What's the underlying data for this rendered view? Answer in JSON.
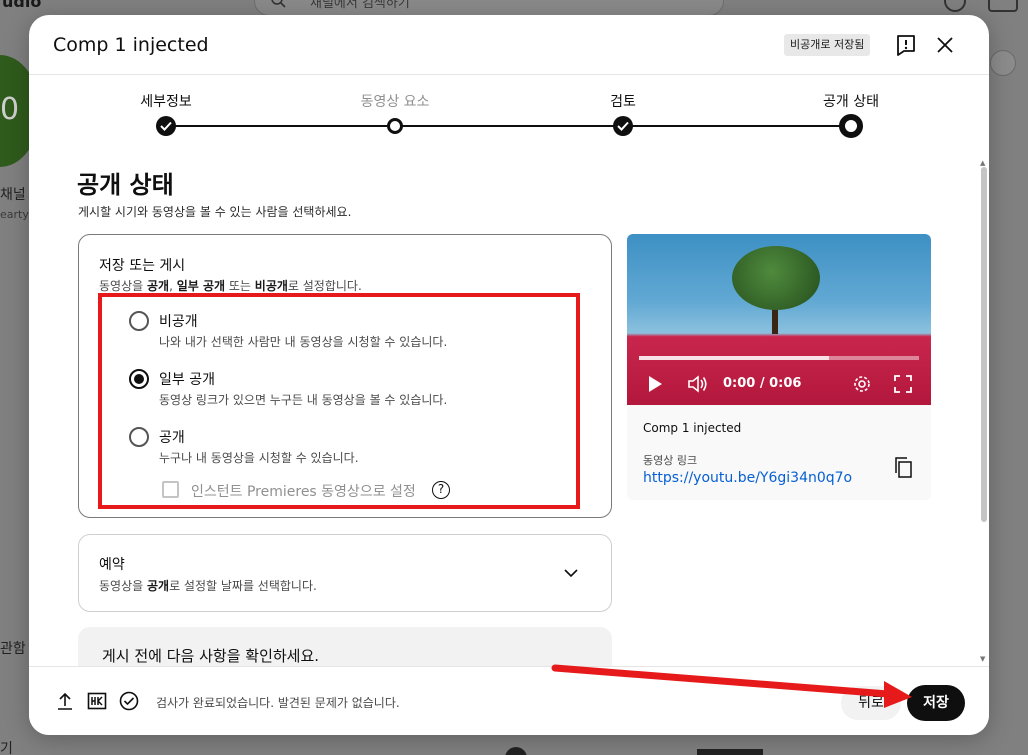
{
  "background": {
    "logo_text": "udio",
    "search_placeholder": "채널에서 검색하기",
    "avatar_letter": "0",
    "channel_label": "채널",
    "channel_sub": "earty",
    "side_item_1": "관함",
    "side_item_2": "기"
  },
  "dialog": {
    "title": "Comp 1 injected",
    "saved_badge": "비공개로 저장됨"
  },
  "stepper": {
    "steps": [
      {
        "label": "세부정보",
        "state": "done"
      },
      {
        "label": "동영상 요소",
        "state": "pending"
      },
      {
        "label": "검토",
        "state": "done"
      },
      {
        "label": "공개 상태",
        "state": "current"
      }
    ]
  },
  "visibility": {
    "title": "공개 상태",
    "subtitle": "게시할 시기와 동영상을 볼 수 있는 사람을 선택하세요.",
    "save_card": {
      "heading": "저장 또는 게시",
      "desc_parts": [
        "동영상을 ",
        "공개",
        ", ",
        "일부 공개",
        " 또는 ",
        "비공개",
        "로 설정합니다."
      ]
    },
    "options": [
      {
        "label": "비공개",
        "desc": "나와 내가 선택한 사람만 내 동영상을 시청할 수 있습니다.",
        "selected": false
      },
      {
        "label": "일부 공개",
        "desc": "동영상 링크가 있으면 누구든 내 동영상을 볼 수 있습니다.",
        "selected": true
      },
      {
        "label": "공개",
        "desc": "누구나 내 동영상을 시청할 수 있습니다.",
        "selected": false
      }
    ],
    "instant_premiere_label": "인스턴트 Premieres 동영상으로 설정",
    "help_glyph": "?",
    "schedule": {
      "heading": "예약",
      "desc_parts": [
        "동영상을 ",
        "공개",
        "로 설정할 날짜를 선택합니다."
      ]
    },
    "check_heading": "게시 전에 다음 사항을 확인하세요."
  },
  "preview": {
    "time": "0:00 / 0:06",
    "title": "Comp 1 injected",
    "link_label": "동영상 링크",
    "link_url": "https://youtu.be/Y6gi34n0q7o"
  },
  "footer": {
    "status_text": "검사가 완료되었습니다. 발견된 문제가 없습니다.",
    "back_label": "뒤로",
    "save_label": "저장"
  },
  "colors": {
    "accent_link": "#065fd4",
    "highlight_red": "#e61a1a",
    "primary_button": "#0f0f0f"
  }
}
